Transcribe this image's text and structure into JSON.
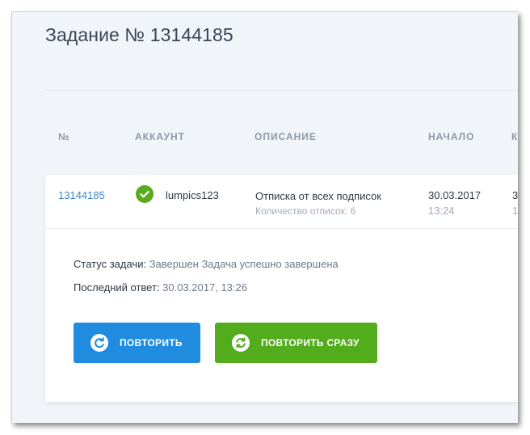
{
  "page": {
    "title": "Задание № 13144185"
  },
  "table": {
    "headers": [
      "№",
      "АККАУНТ",
      "ОПИСАНИЕ",
      "НАЧАЛО",
      "К"
    ],
    "row": {
      "task_id": "13144185",
      "account": "lumpics123",
      "description": "Отписка от всех подписок",
      "description_sub": "Количество отписок: 6",
      "start_date": "30.03.2017",
      "start_time": "13:24",
      "next_col_date": "3",
      "next_col_time": "1"
    }
  },
  "details": {
    "status_label": "Статус задачи:",
    "status_value": "Завершен Задача успешно завершена",
    "last_reply_label": "Последний ответ:",
    "last_reply_value": "30.03.2017, 13:26"
  },
  "buttons": {
    "repeat_label": "ПОВТОРИТЬ",
    "repeat_now_label": "ПОВТОРИТЬ СРАЗУ"
  },
  "colors": {
    "accent_blue": "#1f8ce0",
    "accent_green": "#52ac1c",
    "link": "#3f88c5",
    "status_ok": "#5aaa1e"
  },
  "icons": {
    "account_status": "check-circle-icon",
    "repeat": "refresh-icon",
    "repeat_now": "sync-icon"
  }
}
